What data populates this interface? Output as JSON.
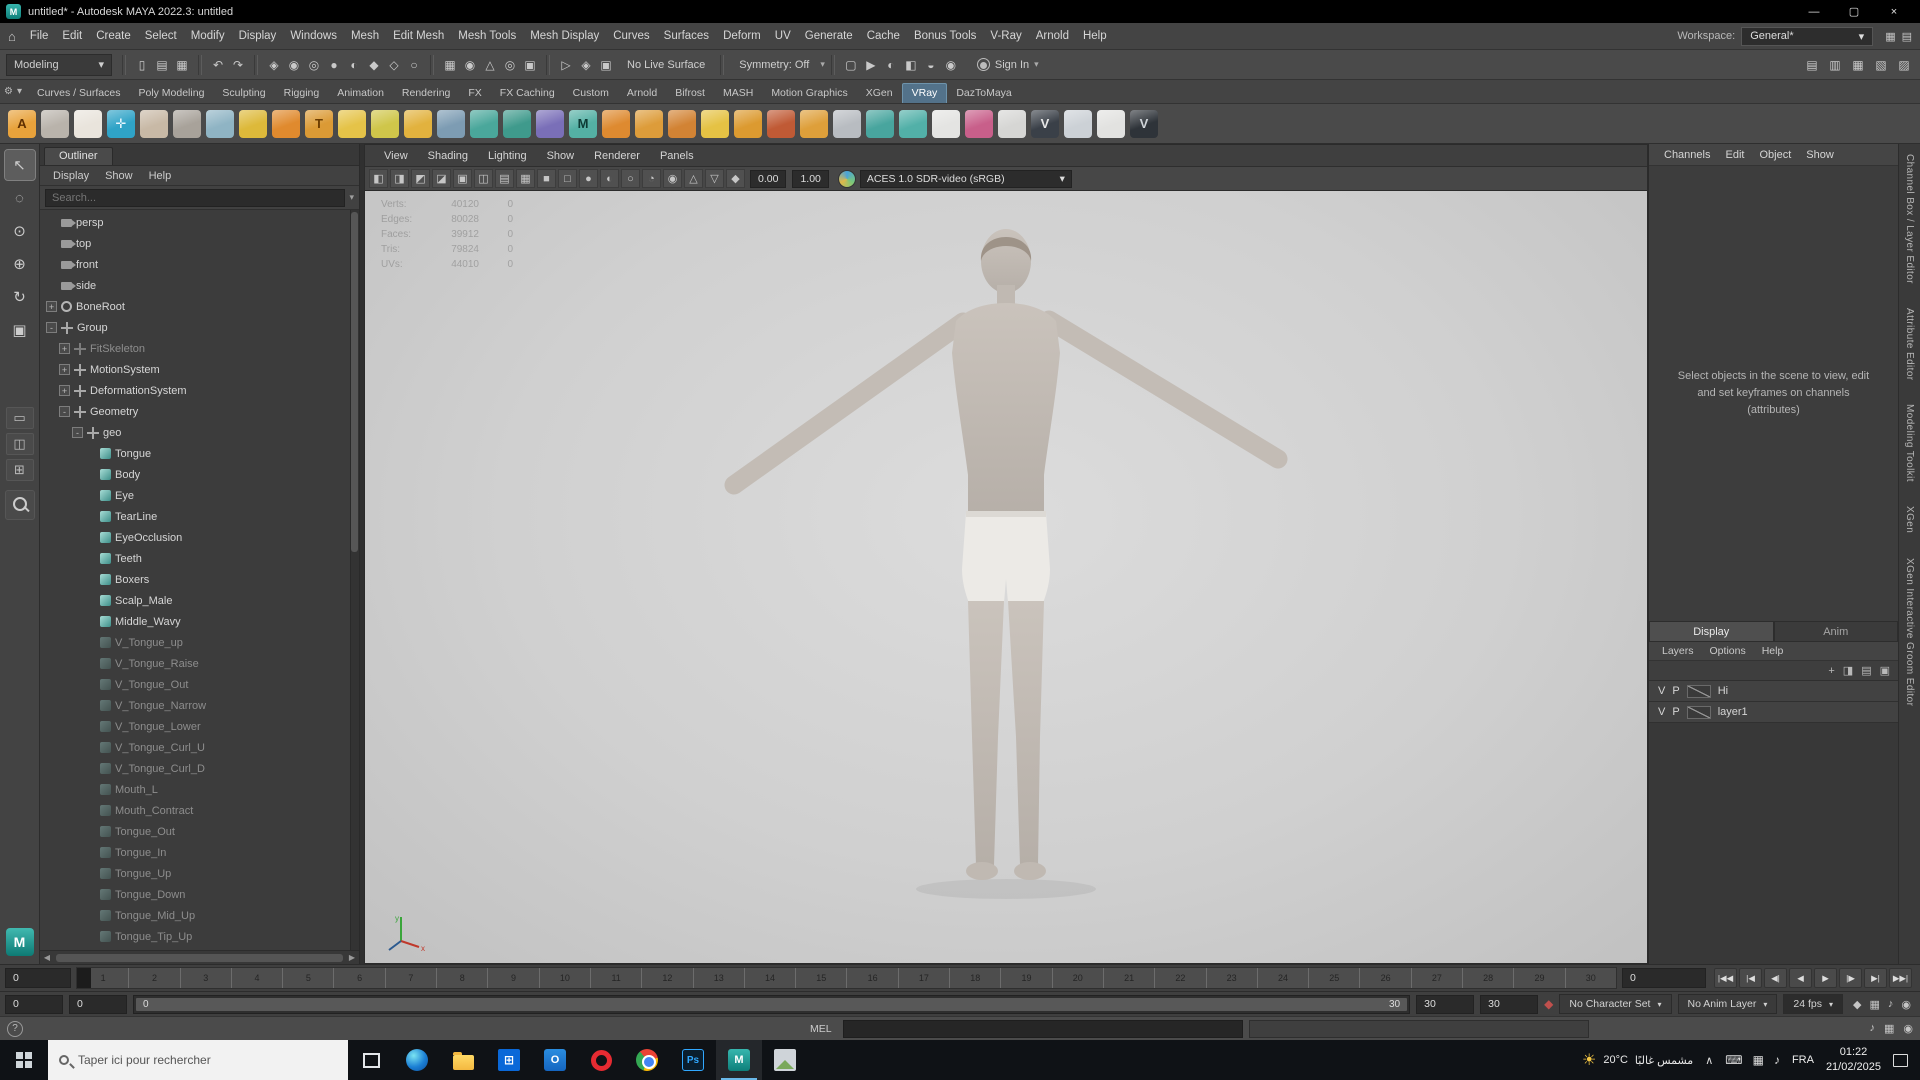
{
  "window": {
    "title": "untitled* - Autodesk MAYA 2022.3: untitled",
    "min": "—",
    "max": "▢",
    "close": "×"
  },
  "menubar": {
    "home_icon": "⌂",
    "items": [
      "File",
      "Edit",
      "Create",
      "Select",
      "Modify",
      "Display",
      "Windows",
      "Mesh",
      "Edit Mesh",
      "Mesh Tools",
      "Mesh Display",
      "Curves",
      "Surfaces",
      "Deform",
      "UV",
      "Generate",
      "Cache",
      "Bonus Tools",
      "V-Ray",
      "Arnold",
      "Help"
    ],
    "workspace_label": "Workspace:",
    "workspace_value": "General*",
    "right_icons": [
      "▦",
      "▤"
    ]
  },
  "statusline": {
    "mode": "Modeling",
    "file_icons": [
      "▯",
      "▤",
      "▦"
    ],
    "undo_icons": [
      "↶",
      "↷"
    ],
    "mask_icons": [
      "◈",
      "◉",
      "◎",
      "●",
      "◐",
      "◆",
      "◇",
      "○"
    ],
    "snap_icons": [
      "▦",
      "◉",
      "△",
      "◎",
      "▣"
    ],
    "hist_icons": [
      "▷",
      "◈",
      "▣"
    ],
    "live_surface": "No Live Surface",
    "symmetry": "Symmetry: Off",
    "render_icons": [
      "▢",
      "▶",
      "◐",
      "◧",
      "◒",
      "◉"
    ],
    "signin": "Sign In",
    "right_icons": [
      "▤",
      "▥",
      "▦",
      "▧",
      "▨"
    ]
  },
  "shelf": {
    "menu_icons": [
      "⚙",
      "▾"
    ],
    "tabs": [
      {
        "label": "Curves / Surfaces"
      },
      {
        "label": "Poly Modeling"
      },
      {
        "label": "Sculpting"
      },
      {
        "label": "Rigging"
      },
      {
        "label": "Animation"
      },
      {
        "label": "Rendering"
      },
      {
        "label": "FX"
      },
      {
        "label": "FX Caching"
      },
      {
        "label": "Custom"
      },
      {
        "label": "Arnold"
      },
      {
        "label": "Bifrost"
      },
      {
        "label": "MASH"
      },
      {
        "label": "Motion Graphics"
      },
      {
        "label": "XGen"
      },
      {
        "label": "VRay",
        "active": true
      },
      {
        "label": "DazToMaya"
      }
    ],
    "icons": [
      {
        "name": "vray-a-icon",
        "bg": "#e8a23b",
        "glyph": "A",
        "fg": "#5f3000"
      },
      {
        "name": "mannequin-icon",
        "bg": "#b9b3ab"
      },
      {
        "name": "mask-icon",
        "bg": "#e9e4dc"
      },
      {
        "name": "rig-figure-icon",
        "bg": "#2fa3c7",
        "glyph": "✛",
        "fg": "#eaf7ff"
      },
      {
        "name": "box-head-icon",
        "bg": "#c8b9a6"
      },
      {
        "name": "head-icon",
        "bg": "#a8a29a"
      },
      {
        "name": "wire-head-icon",
        "bg": "#8fb4c4"
      },
      {
        "name": "yellow-spheres-icon",
        "bg": "#ddb93a"
      },
      {
        "name": "dome-light-icon",
        "bg": "#e08a2e"
      },
      {
        "name": "light-stand-icon",
        "bg": "#db9a35",
        "glyph": "T",
        "fg": "#6b3c00"
      },
      {
        "name": "sphere-light-icon",
        "bg": "#e5c348"
      },
      {
        "name": "atom-icon",
        "bg": "#cfc64a"
      },
      {
        "name": "sun-light-icon",
        "bg": "#e2b23e"
      },
      {
        "name": "render-view-icon",
        "bg": "#7d9cb3"
      },
      {
        "name": "proxy-cubes-icon",
        "bg": "#4aa79b"
      },
      {
        "name": "cube-stack-icon",
        "bg": "#3f9a8c"
      },
      {
        "name": "purple-sphere-icon",
        "bg": "#7a6fb8"
      },
      {
        "name": "vray-material-icon",
        "bg": "#54b0a4",
        "glyph": "M",
        "fg": "#0d3b35"
      },
      {
        "name": "orange-sphere-icon",
        "bg": "#de8a30"
      },
      {
        "name": "cone-icon",
        "bg": "#dd9c3a"
      },
      {
        "name": "brush-icon",
        "bg": "#d28334"
      },
      {
        "name": "grid-window-icon",
        "bg": "#e5c244"
      },
      {
        "name": "grid-sphere-icon",
        "bg": "#dc9a30"
      },
      {
        "name": "grid-box-icon",
        "bg": "#c05a35"
      },
      {
        "name": "torus-icon",
        "bg": "#de9f3a"
      },
      {
        "name": "gear-icon",
        "bg": "#b8bcc1"
      },
      {
        "name": "pyramid-icon",
        "bg": "#48a59e"
      },
      {
        "name": "cubes-icon",
        "bg": "#52b0a8"
      },
      {
        "name": "page-icon",
        "bg": "#e4e4e2"
      },
      {
        "name": "color-wheel-icon",
        "bg": "#c85f8a"
      },
      {
        "name": "dots-icon",
        "bg": "#d6d6d4"
      },
      {
        "name": "vr-sphere-icon",
        "bg": "#3a4048",
        "glyph": "V",
        "fg": "#e8e8e8"
      },
      {
        "name": "flag-icon",
        "bg": "#ccd1d6"
      },
      {
        "name": "ring-sphere-icon",
        "bg": "#e2e2e0"
      },
      {
        "name": "v-dark-icon",
        "bg": "#2e3339",
        "glyph": "V",
        "fg": "#cfd4d9"
      }
    ]
  },
  "toolbox": {
    "tools": [
      {
        "name": "select-tool",
        "glyph": "↖",
        "active": true
      },
      {
        "name": "lasso-tool",
        "glyph": "◌"
      },
      {
        "name": "paint-select-tool",
        "glyph": "⊙"
      },
      {
        "name": "move-tool",
        "glyph": "⊕"
      },
      {
        "name": "rotate-tool",
        "glyph": "↻"
      },
      {
        "name": "scale-tool",
        "glyph": "▣"
      }
    ],
    "layouts": [
      "▭",
      "◫",
      "⊞"
    ]
  },
  "outliner": {
    "title": "Outliner",
    "menus": [
      "Display",
      "Show",
      "Help"
    ],
    "search_placeholder": "Search...",
    "items": [
      {
        "label": "persp",
        "depth": 0,
        "type": "camera",
        "exp": ""
      },
      {
        "label": "top",
        "depth": 0,
        "type": "camera",
        "exp": ""
      },
      {
        "label": "front",
        "depth": 0,
        "type": "camera",
        "exp": ""
      },
      {
        "label": "side",
        "depth": 0,
        "type": "camera",
        "exp": ""
      },
      {
        "label": "BoneRoot",
        "depth": 0,
        "type": "joint",
        "exp": "+"
      },
      {
        "label": "Group",
        "depth": 0,
        "type": "group",
        "exp": "-"
      },
      {
        "label": "FitSkeleton",
        "depth": 1,
        "type": "group",
        "exp": "+",
        "dim": true
      },
      {
        "label": "MotionSystem",
        "depth": 1,
        "type": "group",
        "exp": "+"
      },
      {
        "label": "DeformationSystem",
        "depth": 1,
        "type": "group",
        "exp": "+"
      },
      {
        "label": "Geometry",
        "depth": 1,
        "type": "group",
        "exp": "-"
      },
      {
        "label": "geo",
        "depth": 2,
        "type": "group",
        "exp": "-"
      },
      {
        "label": "Tongue",
        "depth": 3,
        "type": "mesh",
        "exp": ""
      },
      {
        "label": "Body",
        "depth": 3,
        "type": "mesh",
        "exp": ""
      },
      {
        "label": "Eye",
        "depth": 3,
        "type": "mesh",
        "exp": ""
      },
      {
        "label": "TearLine",
        "depth": 3,
        "type": "mesh",
        "exp": ""
      },
      {
        "label": "EyeOcclusion",
        "depth": 3,
        "type": "mesh",
        "exp": ""
      },
      {
        "label": "Teeth",
        "depth": 3,
        "type": "mesh",
        "exp": ""
      },
      {
        "label": "Boxers",
        "depth": 3,
        "type": "mesh",
        "exp": ""
      },
      {
        "label": "Scalp_Male",
        "depth": 3,
        "type": "mesh",
        "exp": ""
      },
      {
        "label": "Middle_Wavy",
        "depth": 3,
        "type": "mesh",
        "exp": ""
      },
      {
        "label": "V_Tongue_up",
        "depth": 3,
        "type": "bs",
        "exp": "",
        "dim": true
      },
      {
        "label": "V_Tongue_Raise",
        "depth": 3,
        "type": "bs",
        "exp": "",
        "dim": true
      },
      {
        "label": "V_Tongue_Out",
        "depth": 3,
        "type": "bs",
        "exp": "",
        "dim": true
      },
      {
        "label": "V_Tongue_Narrow",
        "depth": 3,
        "type": "bs",
        "exp": "",
        "dim": true
      },
      {
        "label": "V_Tongue_Lower",
        "depth": 3,
        "type": "bs",
        "exp": "",
        "dim": true
      },
      {
        "label": "V_Tongue_Curl_U",
        "depth": 3,
        "type": "bs",
        "exp": "",
        "dim": true
      },
      {
        "label": "V_Tongue_Curl_D",
        "depth": 3,
        "type": "bs",
        "exp": "",
        "dim": true
      },
      {
        "label": "Mouth_L",
        "depth": 3,
        "type": "bs",
        "exp": "",
        "dim": true
      },
      {
        "label": "Mouth_Contract",
        "depth": 3,
        "type": "bs",
        "exp": "",
        "dim": true
      },
      {
        "label": "Tongue_Out",
        "depth": 3,
        "type": "bs",
        "exp": "",
        "dim": true
      },
      {
        "label": "Tongue_In",
        "depth": 3,
        "type": "bs",
        "exp": "",
        "dim": true
      },
      {
        "label": "Tongue_Up",
        "depth": 3,
        "type": "bs",
        "exp": "",
        "dim": true
      },
      {
        "label": "Tongue_Down",
        "depth": 3,
        "type": "bs",
        "exp": "",
        "dim": true
      },
      {
        "label": "Tongue_Mid_Up",
        "depth": 3,
        "type": "bs",
        "exp": "",
        "dim": true
      },
      {
        "label": "Tongue_Tip_Up",
        "depth": 3,
        "type": "bs",
        "exp": "",
        "dim": true
      }
    ]
  },
  "viewport": {
    "menus": [
      "View",
      "Shading",
      "Lighting",
      "Show",
      "Renderer",
      "Panels"
    ],
    "toolbar_icons": [
      "◧",
      "◨",
      "◩",
      "◪",
      "▣",
      "◫",
      "▤",
      "▦",
      "■",
      "□",
      "●",
      "◐",
      "○",
      "◔",
      "◉",
      "△",
      "▽",
      "◆"
    ],
    "exposure": "0.00",
    "gamma": "1.00",
    "colorspace": "ACES 1.0 SDR-video (sRGB)",
    "hud": [
      {
        "k": "Verts:",
        "v": "40120",
        "s": "0"
      },
      {
        "k": "Edges:",
        "v": "80028",
        "s": "0"
      },
      {
        "k": "Faces:",
        "v": "39912",
        "s": "0"
      },
      {
        "k": "Tris:",
        "v": "79824",
        "s": "0"
      },
      {
        "k": "UVs:",
        "v": "44010",
        "s": "0"
      }
    ],
    "axis": {
      "x": "x",
      "y": "y",
      "z": "z"
    }
  },
  "channelbox": {
    "menus": [
      "Channels",
      "Edit",
      "Object",
      "Show"
    ],
    "message": "Select objects in the scene to view, edit and set keyframes on channels (attributes)",
    "tabs": [
      {
        "label": "Display",
        "active": true
      },
      {
        "label": "Anim"
      }
    ],
    "layer_menus": [
      "Layers",
      "Options",
      "Help"
    ],
    "icon_row": [
      "+",
      "◨",
      "▤",
      "▣"
    ],
    "layers": [
      {
        "v": "V",
        "p": "P",
        "name": "Hi"
      },
      {
        "v": "V",
        "p": "P",
        "name": "layer1"
      }
    ]
  },
  "side_tabs": [
    "Channel Box / Layer Editor",
    "Attribute Editor",
    "Modeling Toolkit",
    "XGen",
    "XGen Interactive Groom Editor"
  ],
  "timeline": {
    "start_field": "0",
    "ticks": [
      "1",
      "2",
      "3",
      "4",
      "5",
      "6",
      "7",
      "8",
      "9",
      "10",
      "11",
      "12",
      "13",
      "14",
      "15",
      "16",
      "17",
      "18",
      "19",
      "20",
      "21",
      "22",
      "23",
      "24",
      "25",
      "26",
      "27",
      "28",
      "29",
      "30"
    ],
    "current": "0",
    "playback": [
      "|◀◀",
      "|◀",
      "◀|",
      "◀",
      "▶",
      "|▶",
      "▶|",
      "▶▶|"
    ]
  },
  "range": {
    "start": "0",
    "playback_start": "0",
    "bar_start": "0",
    "bar_end": "30",
    "playback_end": "30",
    "end": "30",
    "character_set": "No Character Set",
    "anim_layer": "No Anim Layer",
    "fps": "24 fps",
    "right_icons": [
      "◆",
      "▦",
      "♪",
      "◉"
    ]
  },
  "command": {
    "label": "MEL",
    "help": "?",
    "icons": [
      "♪",
      "▦",
      "◉"
    ]
  },
  "taskbar": {
    "search_placeholder": "Taper ici pour rechercher",
    "apps": [
      {
        "name": "task-view-icon",
        "cls": "taskview"
      },
      {
        "name": "edge-icon",
        "cls": "edge"
      },
      {
        "name": "file-explorer-icon",
        "cls": "folder"
      },
      {
        "name": "microsoft-store-icon",
        "cls": "store",
        "label": "⊞"
      },
      {
        "name": "outlook-icon",
        "cls": "outlook",
        "label": "O"
      },
      {
        "name": "opera-icon",
        "cls": "opera"
      },
      {
        "name": "chrome-icon",
        "cls": "chrome"
      },
      {
        "name": "photoshop-icon",
        "cls": "ps",
        "label": "Ps"
      },
      {
        "name": "maya-icon",
        "cls": "ma",
        "label": "M",
        "active": true
      },
      {
        "name": "screenshot-tool-icon",
        "cls": "shot"
      }
    ],
    "weather_temp": "20°C",
    "weather_text": "مشمس غالبًا",
    "tray_arrow": "∧",
    "tray_icons": [
      "⌨",
      "▦",
      "♪"
    ],
    "lang": "FRA",
    "time": "01:22",
    "date": "21/02/2025"
  }
}
